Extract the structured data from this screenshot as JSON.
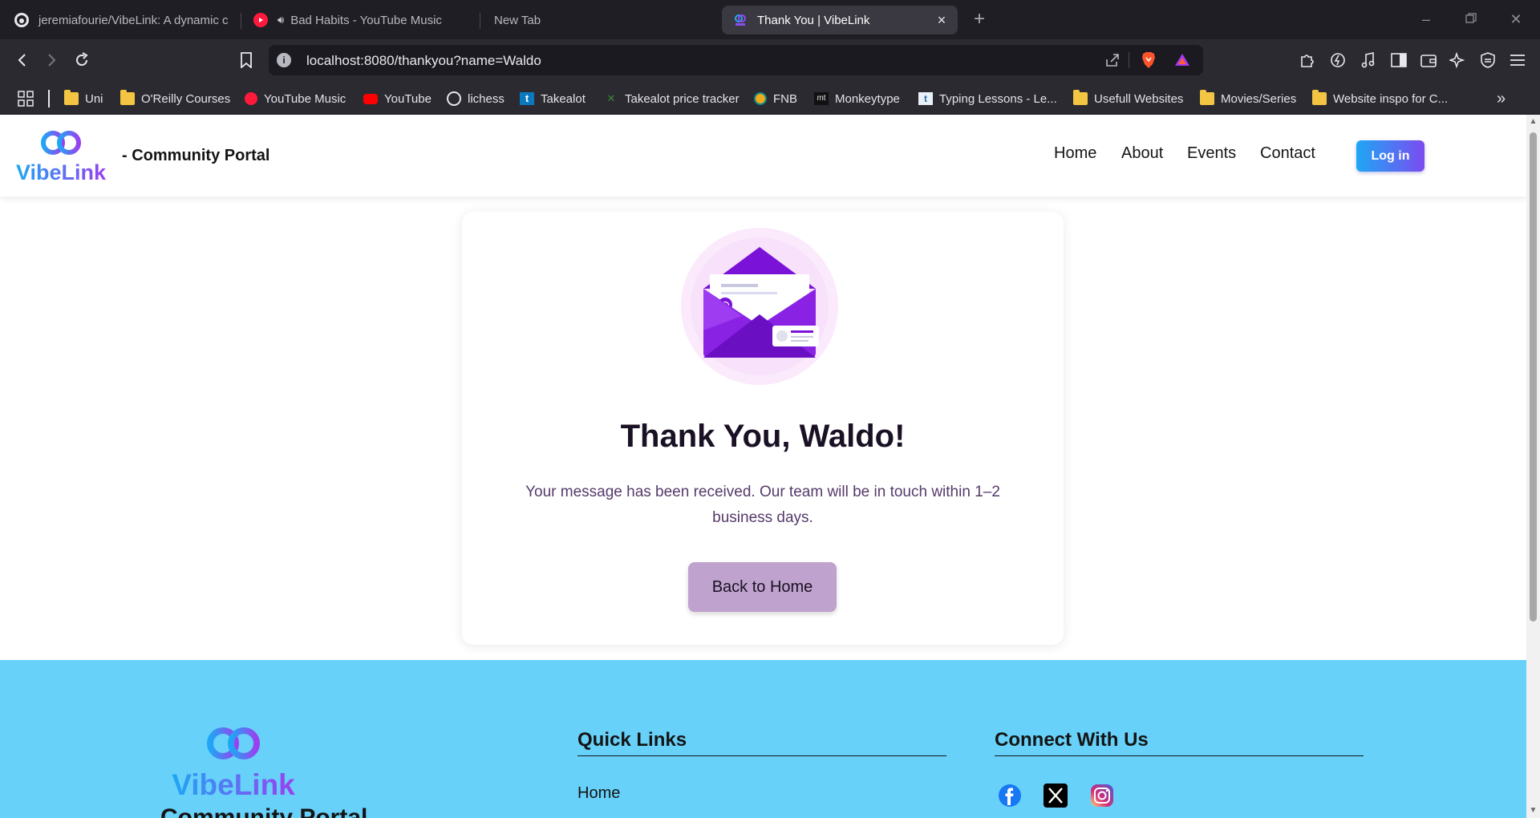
{
  "browser": {
    "tabs": [
      {
        "title": "jeremiafourie/VibeLink: A dynamic c",
        "icon": "github-icon"
      },
      {
        "title": "Bad Habits - YouTube Music",
        "icon": "youtube-music-icon"
      },
      {
        "title": "New Tab",
        "icon": ""
      },
      {
        "title": "Thank You | VibeLink",
        "icon": "vibelink-favicon"
      }
    ],
    "new_tab_symbol": "+",
    "close_tab_symbol": "×",
    "url": "localhost:8080/thankyou?name=Waldo",
    "bookmarks": [
      {
        "label": "Uni",
        "icon": "folder-icon"
      },
      {
        "label": "O'Reilly Courses",
        "icon": "folder-icon"
      },
      {
        "label": "YouTube Music",
        "icon": "youtube-music-icon"
      },
      {
        "label": "YouTube",
        "icon": "youtube-icon"
      },
      {
        "label": "lichess",
        "icon": "lichess-icon"
      },
      {
        "label": "Takealot",
        "icon": "takealot-icon"
      },
      {
        "label": "Takealot price tracker",
        "icon": "tracker-icon"
      },
      {
        "label": "FNB",
        "icon": "fnb-icon"
      },
      {
        "label": "Monkeytype",
        "icon": "monkeytype-icon"
      },
      {
        "label": "Typing Lessons - Le...",
        "icon": "typing-icon"
      },
      {
        "label": "Usefull Websites",
        "icon": "folder-icon"
      },
      {
        "label": "Movies/Series",
        "icon": "folder-icon"
      },
      {
        "label": "Website inspo for C...",
        "icon": "folder-icon"
      }
    ],
    "more_bookmarks_symbol": "»"
  },
  "site": {
    "logo_text": "VibeLink",
    "brand_suffix": "- Community Portal",
    "nav": [
      "Home",
      "About",
      "Events",
      "Contact"
    ],
    "login_label": "Log in"
  },
  "thankyou": {
    "title": "Thank You, Waldo!",
    "message": "Your message has been received. Our team will be in touch within 1–2 business days.",
    "button_label": "Back to Home"
  },
  "footer": {
    "logo_text": "VibeLink",
    "brand": "Community Portal",
    "quick_links_heading": "Quick Links",
    "quick_links": [
      "Home"
    ],
    "connect_heading": "Connect With Us",
    "socials": [
      "facebook-icon",
      "x-icon",
      "instagram-icon"
    ]
  },
  "colors": {
    "accent_gradient_start": "#1ea7f5",
    "accent_gradient_end": "#7b4cf0",
    "envelope_purple": "#7a12d8",
    "button_mauve": "#bfa2cd",
    "footer_bg": "#67d1fa"
  }
}
